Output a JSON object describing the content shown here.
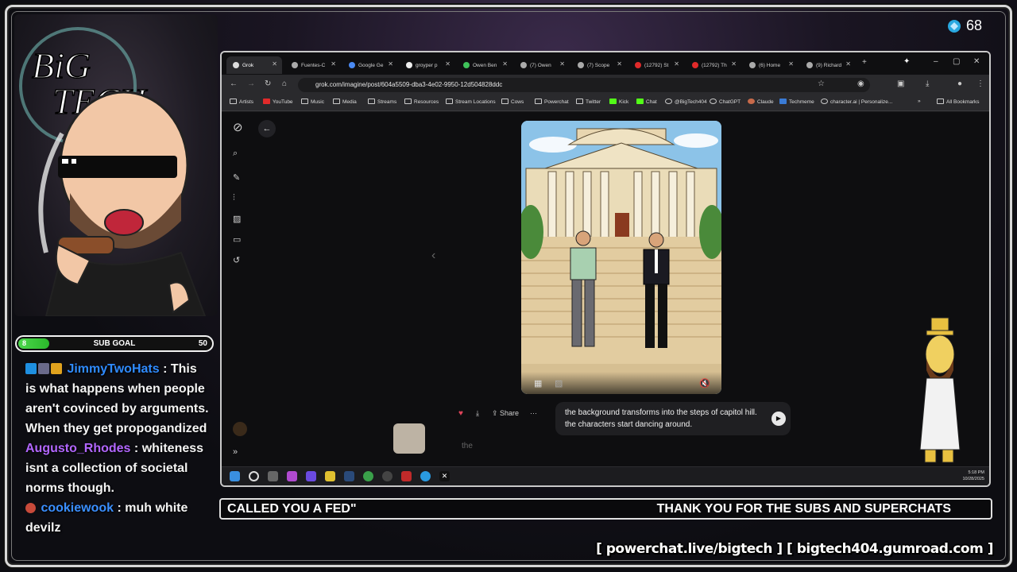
{
  "overlay": {
    "viewer_count": "68",
    "sub_goal": {
      "label": "SUB GOAL",
      "current": "8",
      "max": "50",
      "progress": 0.16
    },
    "ticker_left": "CALLED YOU A FED\"",
    "ticker_right": "THANK YOU FOR THE SUBS AND SUPERCHATS",
    "links": "[ powerchat.live/bigtech ] [ bigtech404.gumroad.com ]"
  },
  "chat": [
    {
      "user": "JimmyTwoHats",
      "color": "#2f8bff",
      "text": "This is what happens when people aren't covinced by arguments. When they get propogandized"
    },
    {
      "user": "Augusto_Rhodes",
      "color": "#b266ff",
      "text": "whiteness isnt a collection of societal norms though."
    },
    {
      "user": "cookiewook",
      "color": "#3a8fff",
      "text": "muh white devilz"
    }
  ],
  "browser": {
    "tabs": [
      "Grok",
      "Fuentes-C",
      "Google Ge",
      "groyper p",
      "Owen Ben",
      "(7) Owen",
      "(7) Scope",
      "(12792) St",
      "(12792) Th",
      "(6) Home",
      "(9) Richard"
    ],
    "url": "grok.com/imagine/post/604a5509-dba3-4e02-9950-12d504828ddc",
    "bookmarks": [
      "Artists",
      "YouTube",
      "Music",
      "Media",
      "Streams",
      "Resources",
      "Stream Locations",
      "Cows",
      "Powerchat",
      "Twitter",
      "Kick",
      "Chat",
      "@BigTech404",
      "ChatGPT",
      "Claude",
      "Techmeme",
      "character.ai | Personalize..."
    ],
    "all_bookmarks": "All Bookmarks",
    "share_label": "Share",
    "more_label": "···",
    "prompt": "the background transforms into the steps of capitol hill. the characters start dancing around.",
    "input_placeholder": "the",
    "clock_time": "5:18 PM",
    "clock_date": "10/28/2025"
  }
}
